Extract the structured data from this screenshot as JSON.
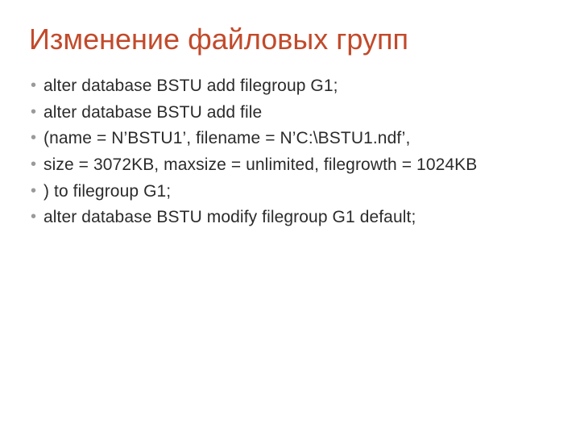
{
  "title": "Изменение файловых групп",
  "items": [
    "alter database BSTU add filegroup G1;",
    "alter database BSTU add file",
    " (name = N’BSTU1’, filename = N’C:\\BSTU1.ndf’,",
    "   size = 3072KB, maxsize = unlimited, filegrowth = 1024KB",
    "  )  to filegroup G1;",
    "alter database BSTU modify filegroup G1 default;"
  ]
}
